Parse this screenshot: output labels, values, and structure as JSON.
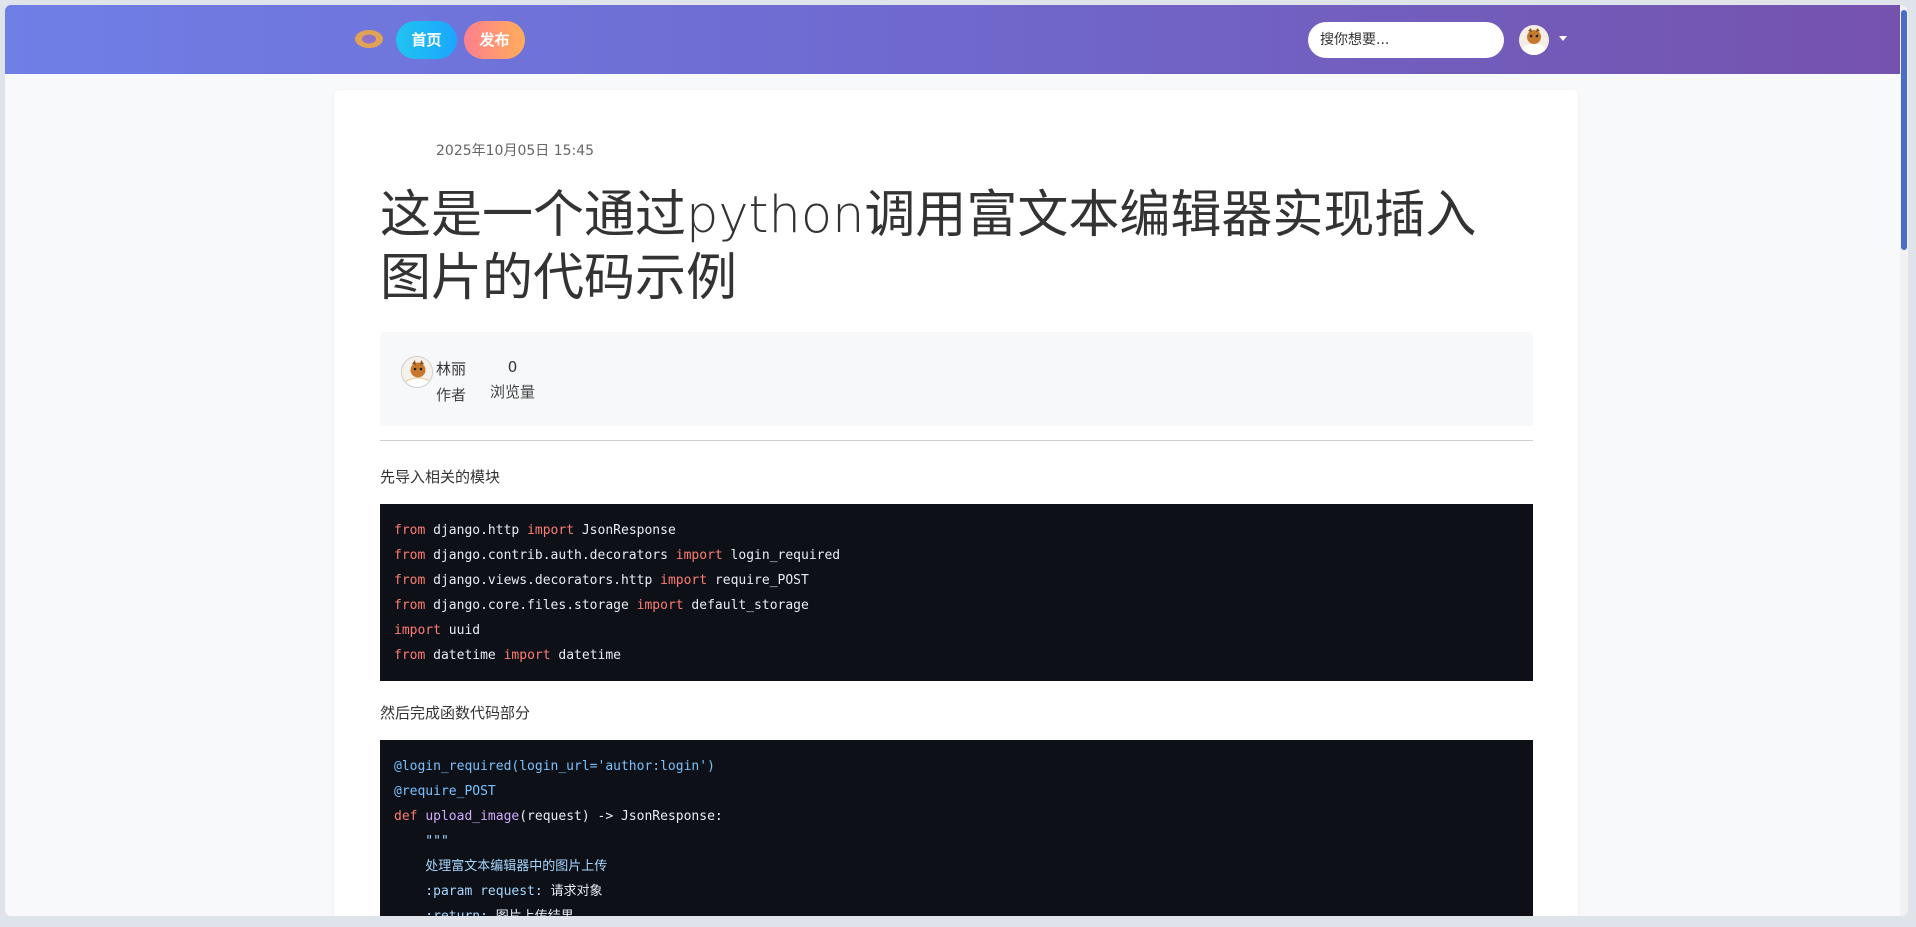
{
  "nav": {
    "home_label": "首页",
    "publish_label": "发布",
    "search_placeholder": "搜你想要..."
  },
  "article": {
    "date": "2025年10月05日 15:45",
    "title": "这是一个通过python调用富文本编辑器实现插入图片的代码示例",
    "author_name": "林丽",
    "author_label": "作者",
    "views": "0",
    "views_label": "浏览量",
    "para1": "先导入相关的模块",
    "para2": "然后完成函数代码部分"
  },
  "code_block_1": [
    [
      {
        "t": "from",
        "c": "kw"
      },
      {
        "t": " django.http "
      },
      {
        "t": "import",
        "c": "kw"
      },
      {
        "t": " JsonResponse"
      }
    ],
    [
      {
        "t": "from",
        "c": "kw"
      },
      {
        "t": " django.contrib.auth.decorators "
      },
      {
        "t": "import",
        "c": "kw"
      },
      {
        "t": " login_required"
      }
    ],
    [
      {
        "t": "from",
        "c": "kw"
      },
      {
        "t": " django.views.decorators.http "
      },
      {
        "t": "import",
        "c": "kw"
      },
      {
        "t": " require_POST"
      }
    ],
    [
      {
        "t": "from",
        "c": "kw"
      },
      {
        "t": " django.core.files.storage "
      },
      {
        "t": "import",
        "c": "kw"
      },
      {
        "t": " default_storage"
      }
    ],
    [
      {
        "t": "import",
        "c": "kw"
      },
      {
        "t": " uuid"
      }
    ],
    [
      {
        "t": "from",
        "c": "kw"
      },
      {
        "t": " datetime "
      },
      {
        "t": "import",
        "c": "kw"
      },
      {
        "t": " datetime"
      }
    ]
  ],
  "code_block_2": [
    [
      {
        "t": "@login_required(login_url='author:login')",
        "c": "dec"
      }
    ],
    [
      {
        "t": "@require_POST",
        "c": "dec"
      }
    ],
    [
      {
        "t": "def",
        "c": "kw"
      },
      {
        "t": " "
      },
      {
        "t": "upload_image",
        "c": "fn"
      },
      {
        "t": "(request) -> JsonResponse:"
      }
    ],
    [
      {
        "t": "    \"\"\"",
        "c": "doc"
      }
    ],
    [
      {
        "t": "    处理富文本编辑器中的图片上传",
        "c": "doc"
      }
    ],
    [
      {
        "t": "    :param request:",
        "c": "doc"
      },
      {
        "t": " 请求对象"
      }
    ],
    [
      {
        "t": "    :return:",
        "c": "doc"
      },
      {
        "t": " 图片上传结果"
      }
    ]
  ]
}
